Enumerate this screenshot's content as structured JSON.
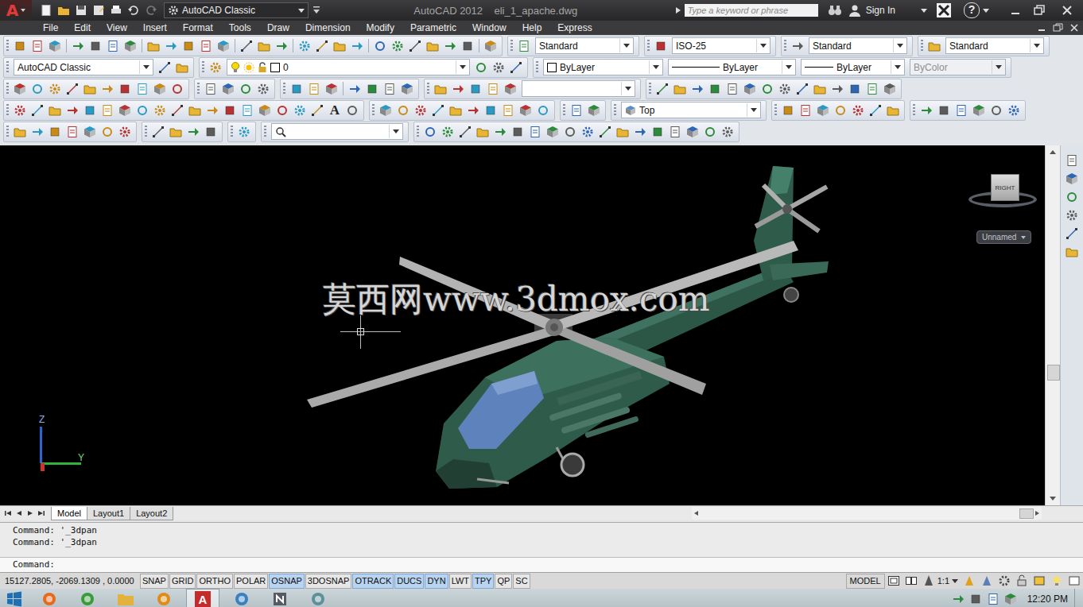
{
  "app": {
    "logo": "A",
    "workspace": "AutoCAD Classic",
    "title": "AutoCAD 2012    eli_1_apache.dwg"
  },
  "search": {
    "placeholder": "Type a keyword or phrase"
  },
  "account": {
    "label": "Sign In"
  },
  "help": "?",
  "menu": [
    "File",
    "Edit",
    "View",
    "Insert",
    "Format",
    "Tools",
    "Draw",
    "Dimension",
    "Modify",
    "Parametric",
    "Window",
    "Help",
    "Express"
  ],
  "toolbars": {
    "styles": [
      "Standard",
      "ISO-25",
      "Standard",
      "Standard"
    ],
    "workspace": "AutoCAD Classic",
    "layer": "0",
    "properties": [
      {
        "kind": "color",
        "value": "ByLayer",
        "disabled": false
      },
      {
        "kind": "linetype",
        "value": "ByLayer",
        "disabled": false
      },
      {
        "kind": "lineweight",
        "value": "ByLayer",
        "disabled": false
      },
      {
        "kind": "plotstyle",
        "value": "ByColor",
        "disabled": true
      }
    ],
    "view": "Top",
    "text_tool": "A"
  },
  "drawing": {
    "watermark": "莫西网www.3dmox.com",
    "viewcube": "RIGHT",
    "named_view": "Unnamed",
    "axes": [
      "Z",
      "Y"
    ]
  },
  "layout_tabs": [
    {
      "label": "Model",
      "selected": true
    },
    {
      "label": "Layout1",
      "selected": false
    },
    {
      "label": "Layout2",
      "selected": false
    }
  ],
  "command": {
    "history": [
      "Command: '_3dpan",
      "Command: '_3dpan"
    ],
    "prompt": "Command:"
  },
  "status_bar": {
    "coordinates": "15127.2805, -2069.1309 , 0.0000",
    "toggles": [
      {
        "label": "SNAP",
        "on": false
      },
      {
        "label": "GRID",
        "on": false
      },
      {
        "label": "ORTHO",
        "on": false
      },
      {
        "label": "POLAR",
        "on": false
      },
      {
        "label": "OSNAP",
        "on": true
      },
      {
        "label": "3DOSNAP",
        "on": false
      },
      {
        "label": "OTRACK",
        "on": true
      },
      {
        "label": "DUCS",
        "on": true
      },
      {
        "label": "DYN",
        "on": true
      },
      {
        "label": "LWT",
        "on": false
      },
      {
        "label": "TPY",
        "on": true
      },
      {
        "label": "QP",
        "on": false
      },
      {
        "label": "SC",
        "on": false
      }
    ],
    "space": "MODEL",
    "scale": "1:1"
  },
  "taskbar": {
    "apps": [
      {
        "kind": "firefox",
        "selected": false
      },
      {
        "kind": "chrome",
        "selected": false
      },
      {
        "kind": "explorer",
        "selected": false
      },
      {
        "kind": "media",
        "selected": false
      },
      {
        "kind": "autocad",
        "selected": true
      },
      {
        "kind": "network",
        "selected": false
      },
      {
        "kind": "notes",
        "selected": false
      },
      {
        "kind": "tool",
        "selected": false
      }
    ],
    "time": "12:20 PM"
  }
}
